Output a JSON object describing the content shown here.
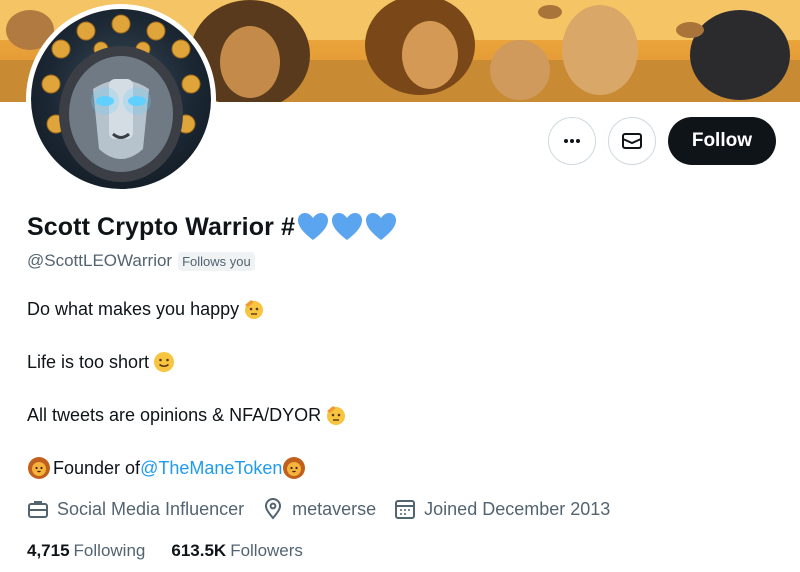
{
  "profile": {
    "display_name": "Scott Crypto Warrior #",
    "handle": "@ScottLEOWarrior",
    "follows_you_badge": "Follows you",
    "heart_color": "#5ba4f0"
  },
  "actions": {
    "more_icon": "more-dots-icon",
    "message_icon": "envelope-icon",
    "follow_label": "Follow"
  },
  "bio": {
    "line1": "Do what makes you happy",
    "line2": "Life is too short",
    "line3": "All tweets are opinions & NFA/DYOR",
    "line4_prefix": "Founder of ",
    "line4_link": "@TheManeToken"
  },
  "meta": {
    "category": "Social Media Influencer",
    "location": "metaverse",
    "joined": "Joined December 2013"
  },
  "stats": {
    "following_count": "4,715",
    "following_label": "Following",
    "followers_count": "613.5K",
    "followers_label": "Followers"
  }
}
